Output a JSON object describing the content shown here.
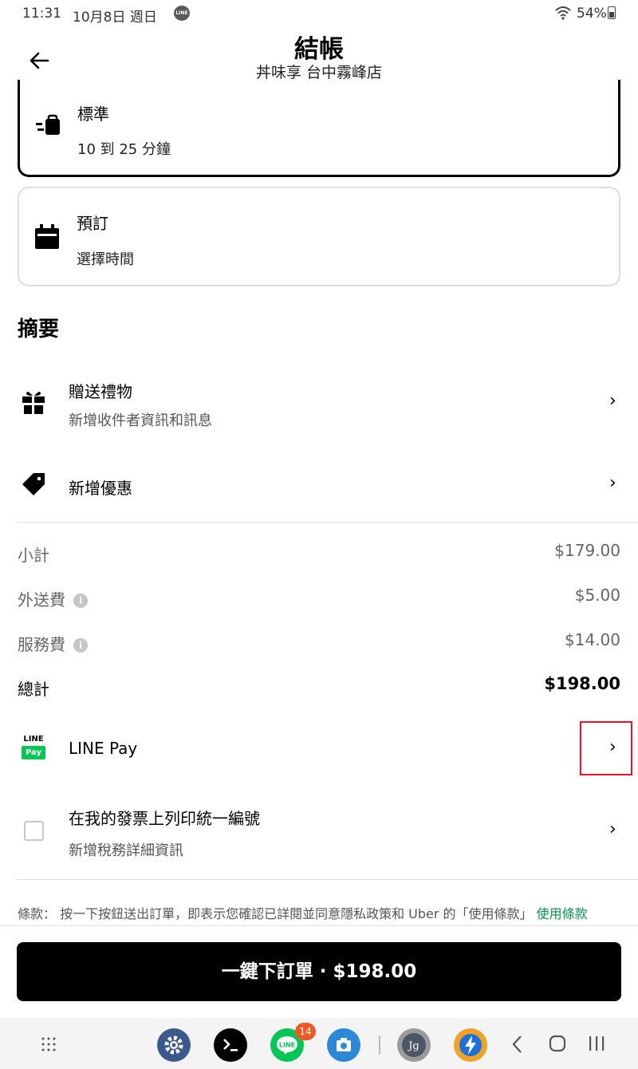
{
  "status_bar": {
    "time": "11:31",
    "date": "10月8日 週日",
    "notification_icon": "LINE",
    "battery": "54%"
  },
  "header": {
    "title": "結帳",
    "subtitle": "丼味享 台中霧峰店",
    "back_icon": "arrow-left-icon"
  },
  "delivery_options": [
    {
      "name": "標準",
      "detail": "10 到 25 分鐘",
      "icon": "delivery-bag-icon",
      "selected": true
    },
    {
      "name": "預訂",
      "detail": "選擇時間",
      "icon": "calendar-icon",
      "selected": false
    }
  ],
  "summary": {
    "title": "摘要",
    "gift": {
      "label": "贈送禮物",
      "sublabel": "新增收件者資訊和訊息",
      "icon": "gift-icon"
    },
    "promo": {
      "label": "新增優惠",
      "icon": "tag-icon"
    }
  },
  "pricing": {
    "subtotal_label": "小計",
    "subtotal_value": "$179.00",
    "delivery_label": "外送費",
    "delivery_value": "$5.00",
    "service_label": "服務費",
    "service_value": "$14.00",
    "total_label": "總計",
    "total_value": "$198.00"
  },
  "payment": {
    "logo_top": "LINE",
    "logo_bottom": "Pay",
    "label": "LINE Pay",
    "chevron": "›"
  },
  "invoice": {
    "label": "在我的發票上列印統一編號",
    "sublabel": "新增稅務詳細資訊"
  },
  "terms": {
    "text": "條款： 按一下按鈕送出訂單，即表示您確認已詳閱並同意隱私政策和 Uber 的「使用條款」",
    "link": "使用條款"
  },
  "order_button": "一鍵下訂單 · $198.00",
  "nav_bar": {
    "apps": [
      "settings-icon",
      "terminal-icon",
      "line-app-icon",
      "camera-icon",
      "jg-app-icon",
      "bolt-app-icon"
    ],
    "line_badge": "14"
  },
  "colors": {
    "accent_green": "#05944f",
    "line_green": "#06c755",
    "highlight_red": "#e8141e"
  }
}
